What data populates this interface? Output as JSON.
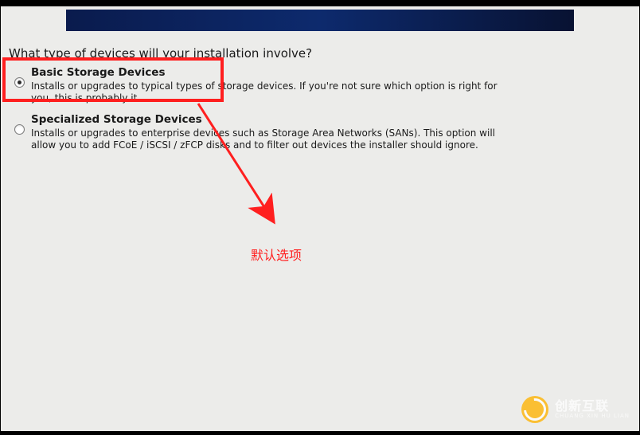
{
  "question": "What type of devices will your installation involve?",
  "options": [
    {
      "title": "Basic Storage Devices",
      "desc": "Installs or upgrades to typical types of storage devices.  If you're not sure which option is right for you, this is probably it.",
      "selected": true
    },
    {
      "title": "Specialized Storage Devices",
      "desc": "Installs or upgrades to enterprise devices such as Storage Area Networks (SANs). This option will allow you to add FCoE / iSCSI / zFCP disks and to filter out devices the installer should ignore.",
      "selected": false
    }
  ],
  "annotation": "默认选项",
  "watermark": {
    "line1": "创新互联",
    "line2": "CHUANG XIN HU LIAN"
  }
}
